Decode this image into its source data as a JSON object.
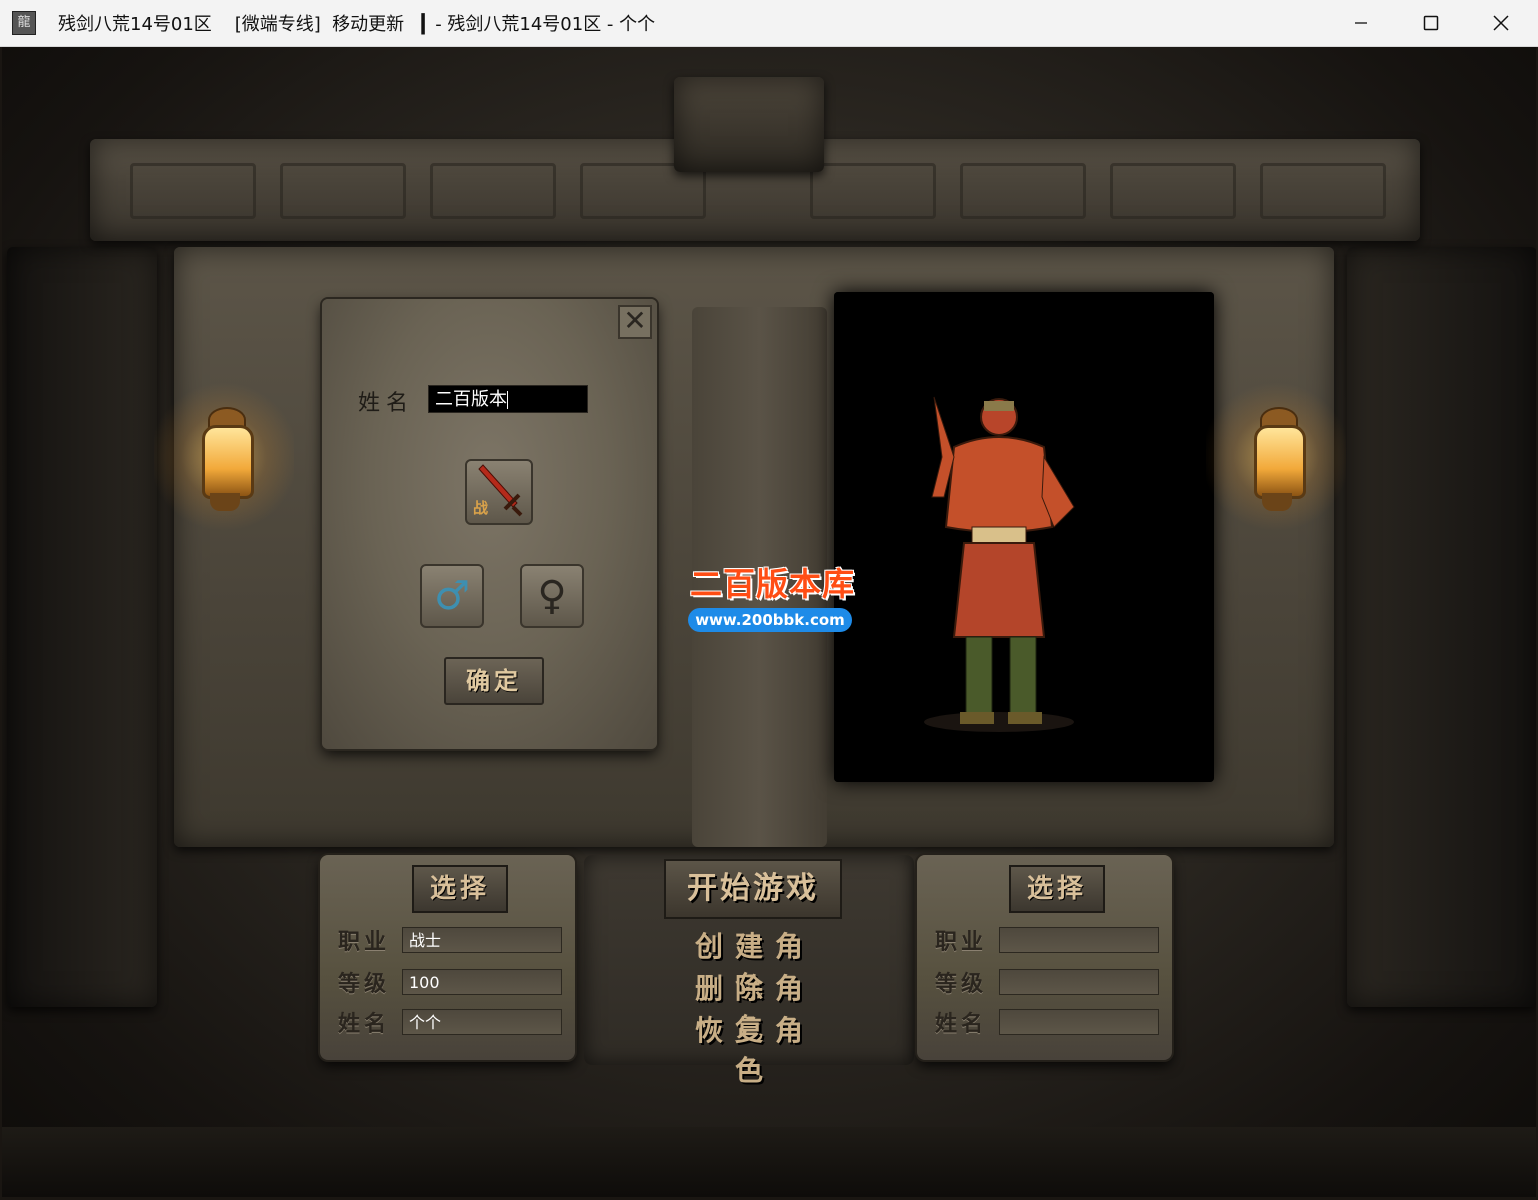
{
  "window": {
    "title": "残剑八荒14号01区    [微端专线]  移动更新   ▎- 残剑八荒14号01区 - 个个",
    "icon_char": "龍"
  },
  "create_panel": {
    "name_label": "姓名",
    "name_value": "二百版本",
    "class_tag": "战",
    "confirm_label": "确定",
    "close_symbol": "✕",
    "male_symbol": "♂",
    "female_symbol": "♀"
  },
  "watermark": {
    "title": "二百版本库",
    "url": "www.200bbk.com"
  },
  "left_slot": {
    "select_label": "选择",
    "rows": [
      {
        "label": "职业",
        "value": "战士"
      },
      {
        "label": "等级",
        "value": "100"
      },
      {
        "label": "姓名",
        "value": "个个"
      }
    ]
  },
  "right_slot": {
    "select_label": "选择",
    "rows": [
      {
        "label": "职业",
        "value": ""
      },
      {
        "label": "等级",
        "value": ""
      },
      {
        "label": "姓名",
        "value": ""
      }
    ]
  },
  "menu": {
    "start_label": "开始游戏",
    "create_label": "创建角色",
    "delete_label": "删除角色",
    "restore_label": "恢复角色"
  },
  "colors": {
    "accent": "#ff4d14",
    "url_badge": "#1e8be8",
    "lamp_glow": "#f2a93a",
    "armor": "#c4502a"
  },
  "icons": {
    "minimize": "minimize-icon",
    "maximize": "maximize-icon",
    "close": "close-icon",
    "class": "sword-icon"
  }
}
